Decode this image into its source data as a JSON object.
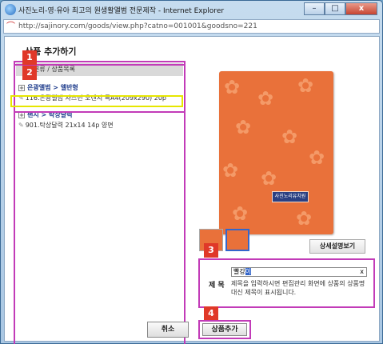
{
  "window": {
    "title": "사진노리-영·유아 최고의 원생활앨범 전문제작 - Internet Explorer",
    "url": "http://sajinory.com/goods/view.php?catno=001001&goodsno=221",
    "buttons": {
      "minimize": "–",
      "maximize": "□",
      "close": "x"
    }
  },
  "page": {
    "title": "상품 추가하기"
  },
  "steps": [
    "1",
    "2",
    "3",
    "4"
  ],
  "category_panel": {
    "breadcrumb": "분류 / 상품목록",
    "groups": [
      {
        "name": "은광앨범 > 앨반형",
        "expander": "+",
        "items": [
          "116.은광앨범 자스민 오렌지 특A4(209x290) 20p"
        ]
      },
      {
        "name": "팬시 > 탁상달력",
        "expander": "+",
        "items": [
          "901.탁상달력 21x14 14p 양면"
        ]
      }
    ]
  },
  "preview": {
    "cover_label": "사진노리유치원"
  },
  "detail_button": "상세설명보기",
  "title_field": {
    "label": "제 목",
    "value_prefix": "빨강",
    "value_highlight": "이",
    "clear": "x",
    "hint": "제목을 입력하시면 편집관리 화면에 상품의 상품명 대신 제목이 표시됩니다."
  },
  "buttons": {
    "cancel": "취소",
    "add": "상품추가"
  }
}
